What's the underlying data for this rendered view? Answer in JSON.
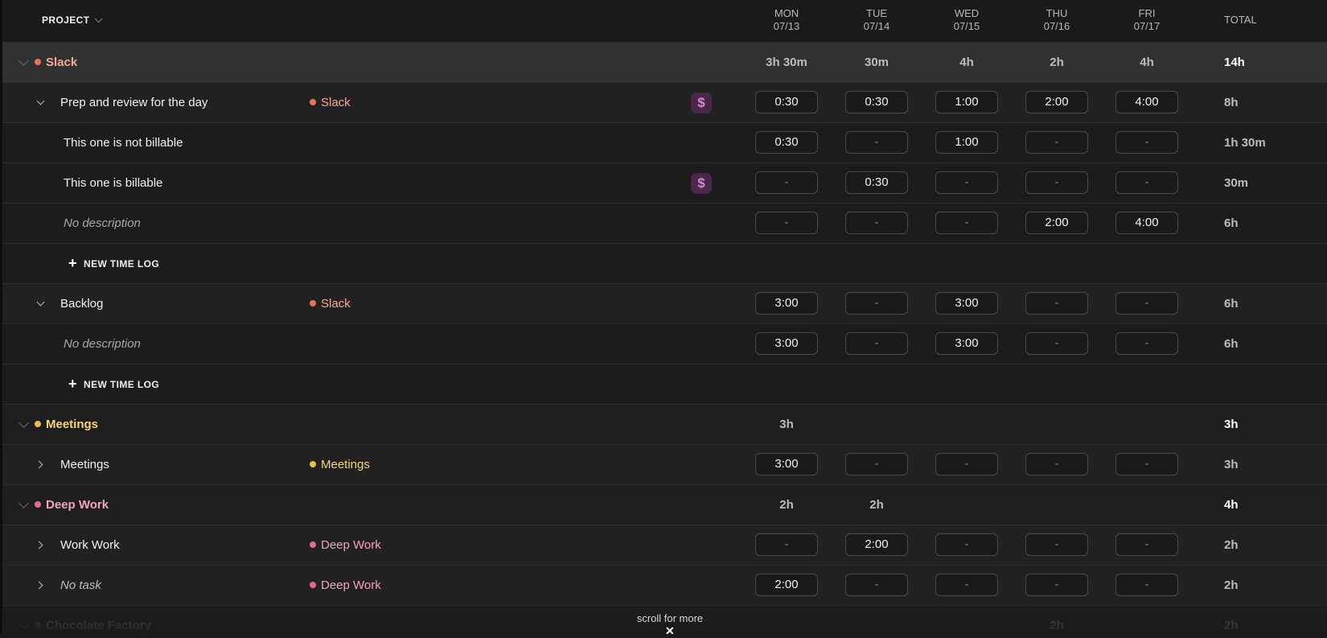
{
  "header": {
    "project_label": "PROJECT",
    "days": [
      {
        "name": "MON",
        "date": "07/13"
      },
      {
        "name": "TUE",
        "date": "07/14"
      },
      {
        "name": "WED",
        "date": "07/15"
      },
      {
        "name": "THU",
        "date": "07/16"
      },
      {
        "name": "FRI",
        "date": "07/17"
      }
    ],
    "total_label": "TOTAL"
  },
  "colors": {
    "slack": "#e8735d",
    "meetings": "#e6c04a",
    "deep_work": "#e06a93",
    "chocolate": "#5a7a4a",
    "money_bg": "#4a2848"
  },
  "groups": {
    "slack": {
      "name": "Slack",
      "values": [
        "3h 30m",
        "30m",
        "4h",
        "2h",
        "4h"
      ],
      "total": "14h"
    },
    "meetings": {
      "name": "Meetings",
      "values": [
        "3h",
        "",
        "",
        "",
        ""
      ],
      "total": "3h"
    },
    "deep_work": {
      "name": "Deep Work",
      "values": [
        "2h",
        "2h",
        "",
        "",
        ""
      ],
      "total": "4h"
    },
    "chocolate": {
      "name": "Chocolate Factory",
      "values": [
        "",
        "",
        "",
        "2h",
        ""
      ],
      "total": "2h"
    }
  },
  "tasks": {
    "prep": {
      "name": "Prep and review for the day",
      "project": "Slack",
      "billable_icon": "$",
      "cells": [
        "0:30",
        "0:30",
        "1:00",
        "2:00",
        "4:00"
      ],
      "total": "8h"
    },
    "backlog": {
      "name": "Backlog",
      "project": "Slack",
      "cells": [
        "3:00",
        "-",
        "3:00",
        "-",
        "-"
      ],
      "total": "6h"
    },
    "meetings": {
      "name": "Meetings",
      "project": "Meetings",
      "cells": [
        "3:00",
        "-",
        "-",
        "-",
        "-"
      ],
      "total": "3h"
    },
    "workwork": {
      "name": "Work Work",
      "project": "Deep Work",
      "cells": [
        "-",
        "2:00",
        "-",
        "-",
        "-"
      ],
      "total": "2h"
    },
    "notask": {
      "name": "No task",
      "project": "Deep Work",
      "cells": [
        "2:00",
        "-",
        "-",
        "-",
        "-"
      ],
      "total": "2h"
    }
  },
  "entries": {
    "notbillable": {
      "desc": "This one is not billable",
      "cells": [
        "0:30",
        "-",
        "1:00",
        "-",
        "-"
      ],
      "total": "1h 30m"
    },
    "billable": {
      "desc": "This one is billable",
      "billable_icon": "$",
      "cells": [
        "-",
        "0:30",
        "-",
        "-",
        "-"
      ],
      "total": "30m"
    },
    "nodesc1": {
      "desc": "No description",
      "cells": [
        "-",
        "-",
        "-",
        "2:00",
        "4:00"
      ],
      "total": "6h"
    },
    "nodesc2": {
      "desc": "No description",
      "cells": [
        "3:00",
        "-",
        "3:00",
        "-",
        "-"
      ],
      "total": "6h"
    }
  },
  "new_time_log_label": "NEW TIME LOG",
  "scroll_hint": "scroll for more",
  "scroll_icon": "close-x"
}
